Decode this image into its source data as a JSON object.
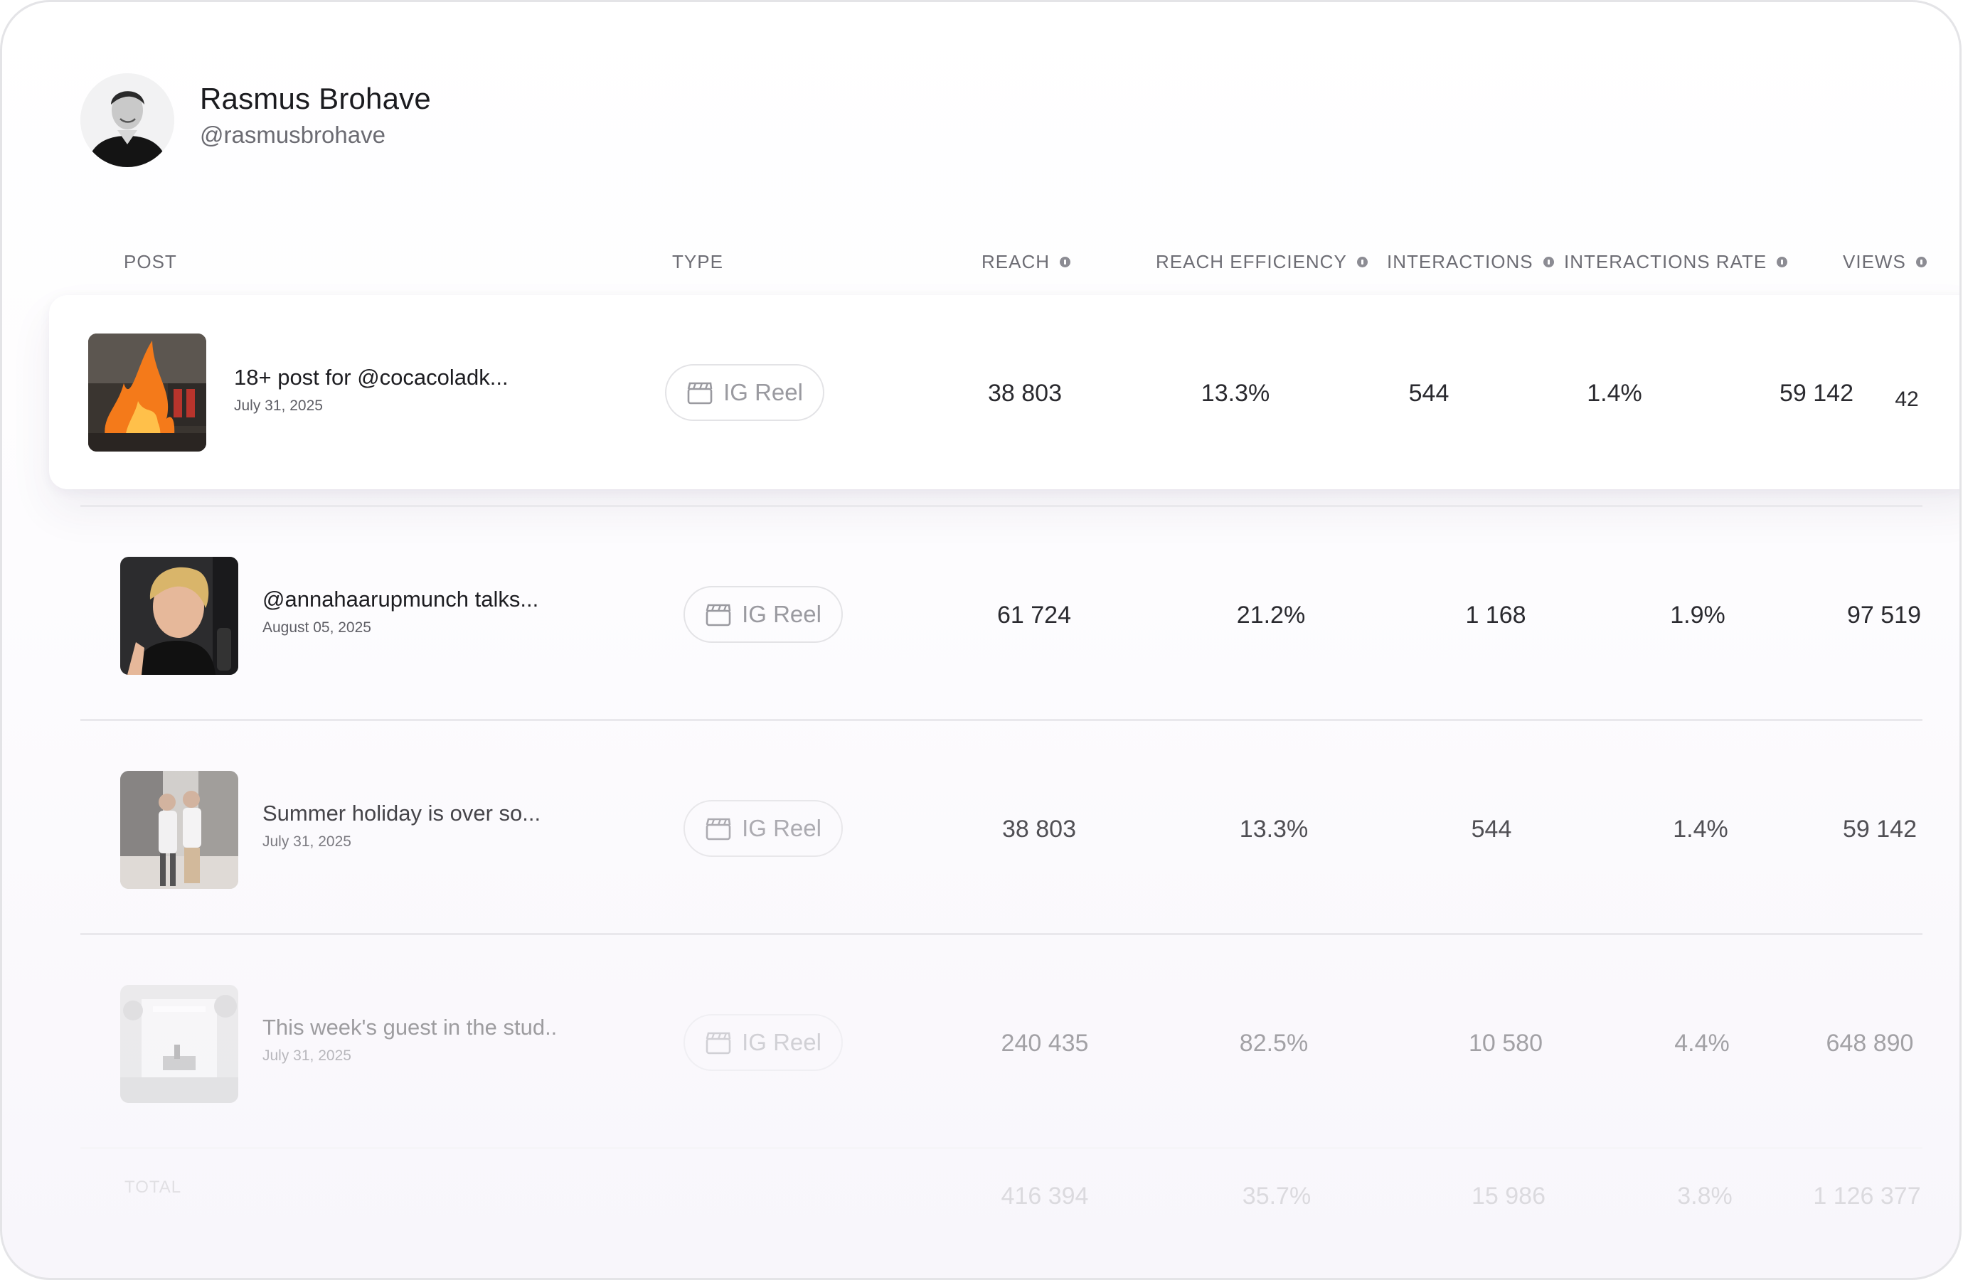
{
  "profile": {
    "name": "Rasmus Brohave",
    "handle": "@rasmusbrohave"
  },
  "columns": {
    "post": "POST",
    "type": "TYPE",
    "reach": "REACH",
    "reach_efficiency": "REACH EFFICIENCY",
    "interactions": "INTERACTIONS",
    "interactions_rate": "INTERACTIONS RATE",
    "views": "VIEWS"
  },
  "rows": [
    {
      "title": "18+ post for @cocacoladk...",
      "date": "July 31, 2025",
      "type": "IG Reel",
      "reach": "38 803",
      "reach_efficiency": "13.3%",
      "interactions": "544",
      "interactions_rate": "1.4%",
      "views": "59 142",
      "extra": "42"
    },
    {
      "title": "@annahaarupmunch talks...",
      "date": "August 05, 2025",
      "type": "IG Reel",
      "reach": "61 724",
      "reach_efficiency": "21.2%",
      "interactions": "1 168",
      "interactions_rate": "1.9%",
      "views": "97 519"
    },
    {
      "title": "Summer holiday is over so...",
      "date": "July 31, 2025",
      "type": "IG Reel",
      "reach": "38 803",
      "reach_efficiency": "13.3%",
      "interactions": "544",
      "interactions_rate": "1.4%",
      "views": "59 142"
    },
    {
      "title": "This week's guest in the stud..",
      "date": "July 31, 2025",
      "type": "IG Reel",
      "reach": "240 435",
      "reach_efficiency": "82.5%",
      "interactions": "10 580",
      "interactions_rate": "4.4%",
      "views": "648 890"
    }
  ],
  "total": {
    "label": "TOTAL",
    "reach": "416 394",
    "reach_efficiency": "35.7%",
    "interactions": "15 986",
    "interactions_rate": "3.8%",
    "views": "1 126 377"
  },
  "icons": {
    "type": "clapperboard-icon",
    "info": "info-icon"
  }
}
